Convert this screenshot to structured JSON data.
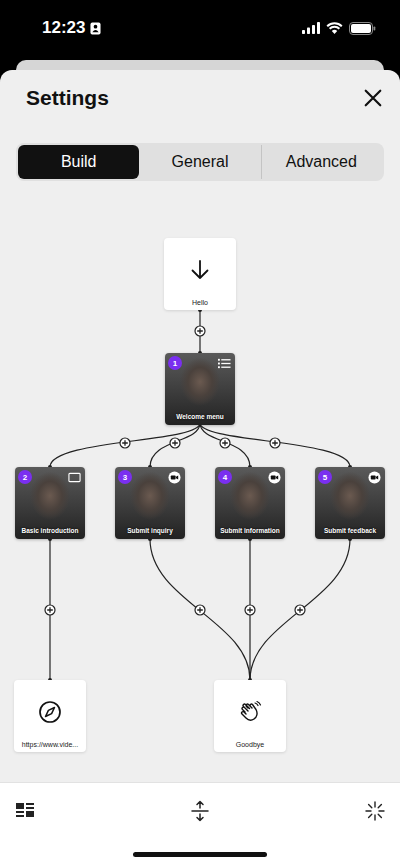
{
  "status_bar": {
    "time": "12:23"
  },
  "header": {
    "title": "Settings"
  },
  "tabs": [
    {
      "label": "Build",
      "selected": true
    },
    {
      "label": "General",
      "selected": false
    },
    {
      "label": "Advanced",
      "selected": false
    }
  ],
  "diagram": {
    "start": {
      "label": "Hello"
    },
    "menu": {
      "badge": "1",
      "label": "Welcome menu",
      "answer_type": "menu"
    },
    "branches": [
      {
        "badge": "2",
        "label": "Basic introduction",
        "answer_type": "screen"
      },
      {
        "badge": "3",
        "label": "Submit inquiry",
        "answer_type": "video"
      },
      {
        "badge": "4",
        "label": "Submit information",
        "answer_type": "video"
      },
      {
        "badge": "5",
        "label": "Submit feedback",
        "answer_type": "video"
      }
    ],
    "ends": [
      {
        "kind": "redirect",
        "label": "https://www.vide...",
        "from": [
          "2"
        ]
      },
      {
        "kind": "end",
        "label": "Goodbye",
        "from": [
          "3",
          "4",
          "5"
        ]
      }
    ]
  }
}
